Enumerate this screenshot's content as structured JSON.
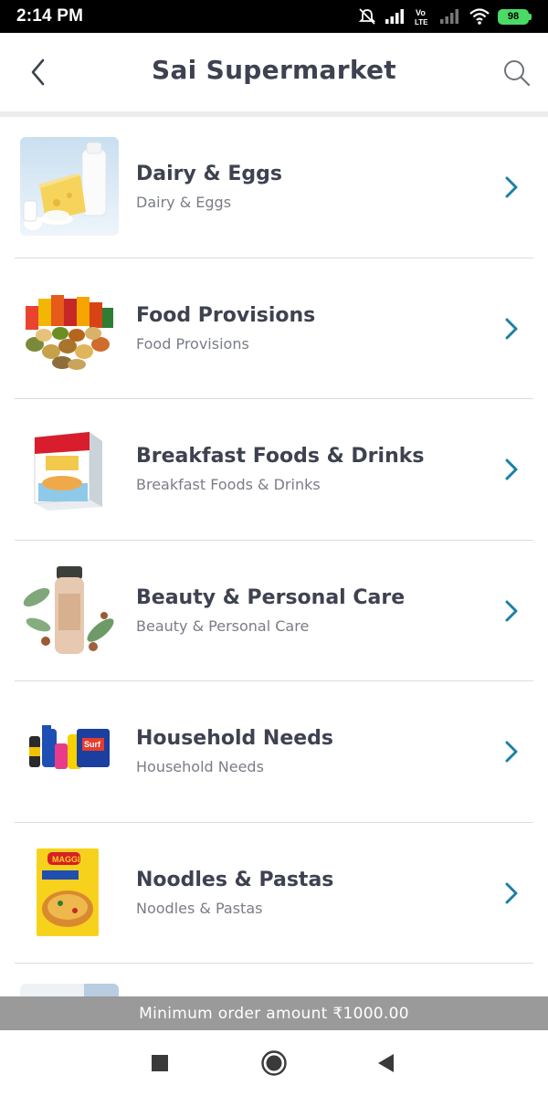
{
  "status_bar": {
    "time": "2:14 PM",
    "battery": "98"
  },
  "header": {
    "title": "Sai Supermarket"
  },
  "categories": [
    {
      "title": "Dairy & Eggs",
      "subtitle": "Dairy & Eggs",
      "icon": "dairy-eggs-image"
    },
    {
      "title": "Food Provisions",
      "subtitle": "Food Provisions",
      "icon": "food-provisions-image"
    },
    {
      "title": "Breakfast Foods & Drinks",
      "subtitle": "Breakfast Foods & Drinks",
      "icon": "breakfast-image"
    },
    {
      "title": "Beauty & Personal Care",
      "subtitle": "Beauty & Personal Care",
      "icon": "beauty-image"
    },
    {
      "title": "Household Needs",
      "subtitle": "Household Needs",
      "icon": "household-image"
    },
    {
      "title": "Noodles & Pastas",
      "subtitle": "Noodles & Pastas",
      "icon": "noodles-image"
    }
  ],
  "banner": {
    "min_order": "Minimum order amount ₹1000.00"
  },
  "colors": {
    "accent": "#1d7fa6",
    "title": "#3e4250",
    "banner": "#9a9a9a"
  }
}
